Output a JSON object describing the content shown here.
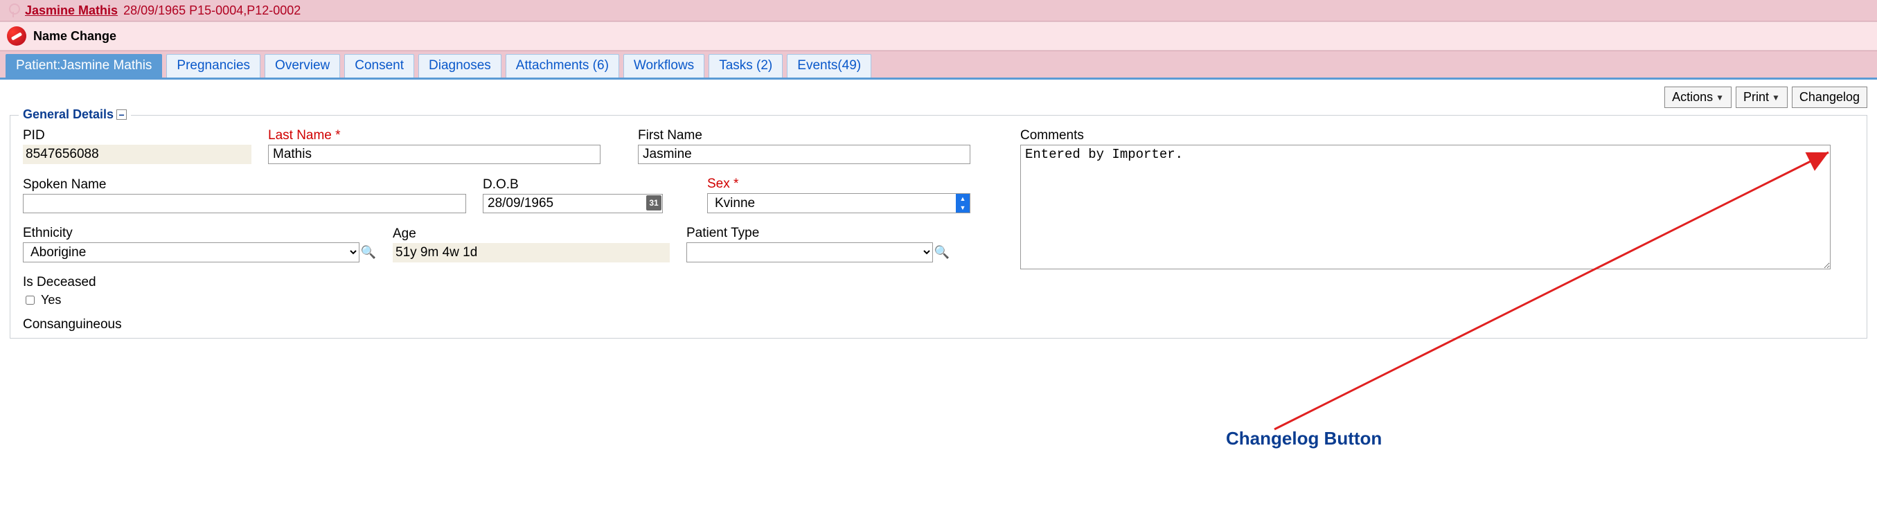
{
  "header": {
    "patient_name": "Jasmine Mathis",
    "meta": "28/09/1965 P15-0004,P12-0002",
    "warning_label": "Name Change"
  },
  "tabs": [
    {
      "label": "Patient:Jasmine Mathis",
      "active": true
    },
    {
      "label": "Pregnancies"
    },
    {
      "label": "Overview"
    },
    {
      "label": "Consent"
    },
    {
      "label": "Diagnoses"
    },
    {
      "label": "Attachments (6)"
    },
    {
      "label": "Workflows"
    },
    {
      "label": "Tasks (2)"
    },
    {
      "label": "Events(49)"
    }
  ],
  "actions": {
    "actions_btn": "Actions",
    "print_btn": "Print",
    "changelog_btn": "Changelog"
  },
  "panel_title": "General Details",
  "fields": {
    "pid_label": "PID",
    "pid_value": "8547656088",
    "lastname_label": "Last Name",
    "lastname_value": "Mathis",
    "firstname_label": "First Name",
    "firstname_value": "Jasmine",
    "spokenname_label": "Spoken Name",
    "spokenname_value": "",
    "dob_label": "D.O.B",
    "dob_value": "28/09/1965",
    "cal_text": "31",
    "sex_label": "Sex",
    "sex_value": "Kvinne",
    "ethnicity_label": "Ethnicity",
    "ethnicity_value": "Aborigine",
    "age_label": "Age",
    "age_value": "51y 9m 4w 1d",
    "patienttype_label": "Patient Type",
    "patienttype_value": "",
    "isdeceased_label": "Is Deceased",
    "isdeceased_opt": "Yes",
    "consang_label": "Consanguineous",
    "comments_label": "Comments",
    "comments_value": "Entered by Importer."
  },
  "annotation": {
    "label": "Changelog Button"
  }
}
